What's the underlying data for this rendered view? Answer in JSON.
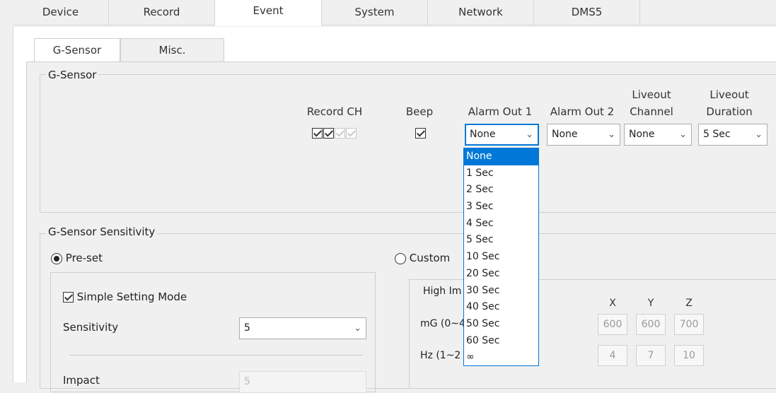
{
  "top_tabs": [
    "Device",
    "Record",
    "Event",
    "System",
    "Network",
    "DMS5"
  ],
  "sub_tabs": [
    "G-Sensor",
    "Misc."
  ],
  "gsensor_group": {
    "title": "G-Sensor",
    "record_ch_label": "Record CH",
    "beep_label": "Beep",
    "alarm_out1_label": "Alarm Out 1",
    "alarm_out2_label": "Alarm Out 2",
    "liveout_channel_label_1": "Liveout",
    "liveout_channel_label_2": "Channel",
    "liveout_duration_label_1": "Liveout",
    "liveout_duration_label_2": "Duration",
    "record_ch_states": [
      true,
      true,
      false,
      false
    ],
    "beep_checked": true,
    "alarm_out1_value": "None",
    "alarm_out2_value": "None",
    "liveout_channel_value": "None",
    "liveout_duration_value": "5 Sec"
  },
  "alarm_dropdown": {
    "options": [
      "None",
      "1 Sec",
      "2 Sec",
      "3 Sec",
      "4 Sec",
      "5 Sec",
      "10 Sec",
      "20 Sec",
      "30 Sec",
      "40 Sec",
      "50 Sec",
      "60 Sec",
      "∞"
    ],
    "selected": "None"
  },
  "sensitivity_group": {
    "title": "G-Sensor Sensitivity",
    "preset_label": "Pre-set",
    "custom_label": "Custom",
    "simple_setting_label": "Simple Setting Mode",
    "sensitivity_label": "Sensitivity",
    "sensitivity_value": "5",
    "impact_label": "Impact",
    "impact_value": "5",
    "high_impact_title": "High Im",
    "mg_label": "mG (0~4",
    "hz_label": "Hz (1~2",
    "axes": [
      "X",
      "Y",
      "Z"
    ],
    "mg_values": [
      "600",
      "600",
      "700"
    ],
    "hz_values": [
      "4",
      "7",
      "10"
    ]
  },
  "icons": {
    "chevron": "chevron-down-icon",
    "check": "checkbox-check-icon"
  }
}
